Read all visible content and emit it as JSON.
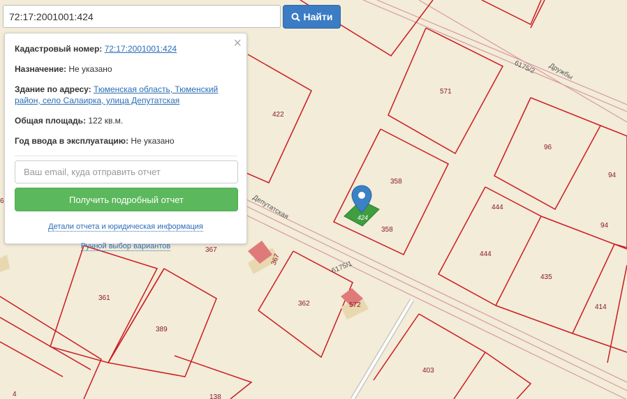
{
  "search": {
    "value": "72:17:2001001:424",
    "button_label": "Найти",
    "button_icon": "search-icon"
  },
  "popup": {
    "cadastral_label": "Кадастровый номер:",
    "cadastral_value": "72:17:2001001:424",
    "purpose_label": "Назначение:",
    "purpose_value": "Не указано",
    "address_label": "Здание по адресу:",
    "address_value": "Тюменская область, Тюменский район, село Салаирка, улица Депутатская",
    "area_label": "Общая площадь:",
    "area_value": "122 кв.м.",
    "year_label": "Год ввода в эксплуатацию:",
    "year_value": "Не указано",
    "email_placeholder": "Ваш email, куда отправить отчет",
    "report_button": "Получить подробный отчет",
    "details_link": "Детали отчета и юридическая информация",
    "manual_link": "Ручной выбор вариантов",
    "close_icon": "close-icon"
  },
  "map": {
    "parcels": [
      "422",
      "571",
      "96",
      "94",
      "94",
      "358",
      "358",
      "444",
      "444",
      "435",
      "414",
      "367",
      "367",
      "361",
      "362",
      "572",
      "389",
      "403",
      "138",
      "6",
      "4"
    ],
    "streets": [
      "Дружбы",
      "Депутатская"
    ],
    "quarters": [
      "6175/2",
      "6175/1"
    ],
    "marker_label": "424",
    "marker_icon": "map-pin-icon",
    "colors": {
      "background": "#f2ecd8",
      "parcel_border": "#cc1a22",
      "highlight": "#3f9e3f",
      "building": "#e07a7a",
      "marker": "#3b82c4"
    }
  }
}
